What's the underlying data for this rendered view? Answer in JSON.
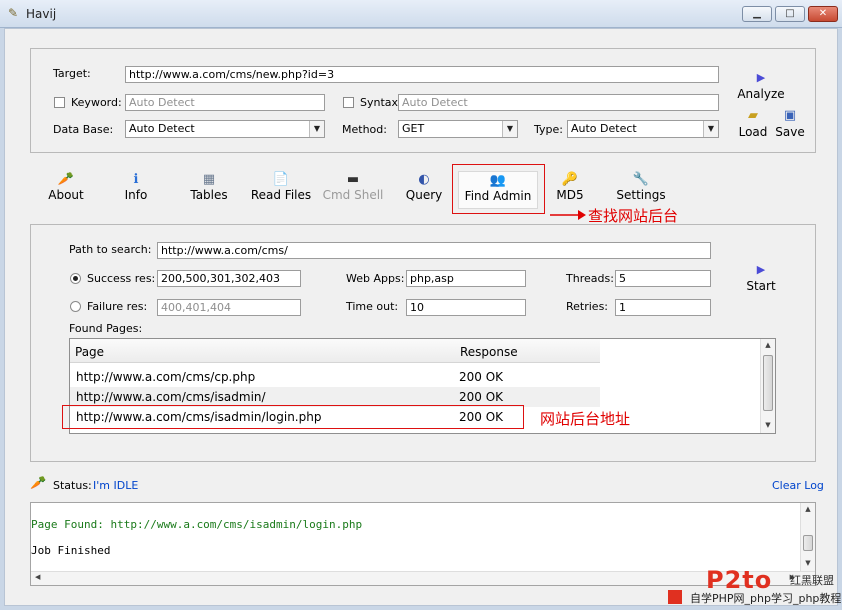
{
  "window": {
    "title": "Havij",
    "minimize": "▁",
    "maximize": "□",
    "close": "✕"
  },
  "target_panel": {
    "target_label": "Target:",
    "target_value": "http://www.a.com/cms/new.php?id=3",
    "keyword_label": "Keyword:",
    "keyword_value": "Auto Detect",
    "syntax_label": "Syntax:",
    "syntax_value": "Auto Detect",
    "database_label": "Data Base:",
    "database_value": "Auto Detect",
    "method_label": "Method:",
    "method_value": "GET",
    "type_label": "Type:",
    "type_value": "Auto Detect",
    "analyze_label": "Analyze",
    "load_label": "Load",
    "save_label": "Save"
  },
  "toolbar": [
    {
      "label": "About",
      "icon": "🥕"
    },
    {
      "label": "Info",
      "icon": "ℹ"
    },
    {
      "label": "Tables",
      "icon": "▦"
    },
    {
      "label": "Read Files",
      "icon": "📄"
    },
    {
      "label": "Cmd Shell",
      "icon": "▬"
    },
    {
      "label": "Query",
      "icon": "◐"
    },
    {
      "label": "Find Admin",
      "icon": "👥"
    },
    {
      "label": "MD5",
      "icon": "🔑"
    },
    {
      "label": "Settings",
      "icon": "🔧"
    }
  ],
  "annotations": {
    "find_admin_note": "查找网站后台",
    "admin_address_note": "网站后台地址"
  },
  "find_admin": {
    "path_label": "Path to search:",
    "path_value": "http://www.a.com/cms/",
    "success_label": "Success res:",
    "success_value": "200,500,301,302,403",
    "failure_label": "Failure res:",
    "failure_value": "400,401,404",
    "webapps_label": "Web Apps:",
    "webapps_value": "php,asp",
    "timeout_label": "Time out:",
    "timeout_value": "10",
    "threads_label": "Threads:",
    "threads_value": "5",
    "retries_label": "Retries:",
    "retries_value": "1",
    "start_label": "Start",
    "found_label": "Found Pages:",
    "columns": {
      "page": "Page",
      "response": "Response"
    },
    "rows": [
      {
        "page": "http://www.a.com/cms/cp.php",
        "response": "200 OK"
      },
      {
        "page": "http://www.a.com/cms/isadmin/",
        "response": "200 OK"
      },
      {
        "page": "http://www.a.com/cms/isadmin/login.php",
        "response": "200 OK"
      }
    ]
  },
  "status": {
    "label": "Status:",
    "value": "I'm IDLE",
    "clear_log": "Clear Log"
  },
  "log": {
    "lines": [
      "Page Found: http://www.a.com/cms/isadmin/login.php",
      "Job Finished"
    ]
  },
  "watermark": {
    "logo": "P2to",
    "brand": "红黑联盟",
    "tagline": "自学PHP网_php学习_php教程"
  },
  "colors": {
    "accent_link": "#0044cc",
    "annotation_red": "#e00000",
    "log_green": "#1a7a1a"
  }
}
